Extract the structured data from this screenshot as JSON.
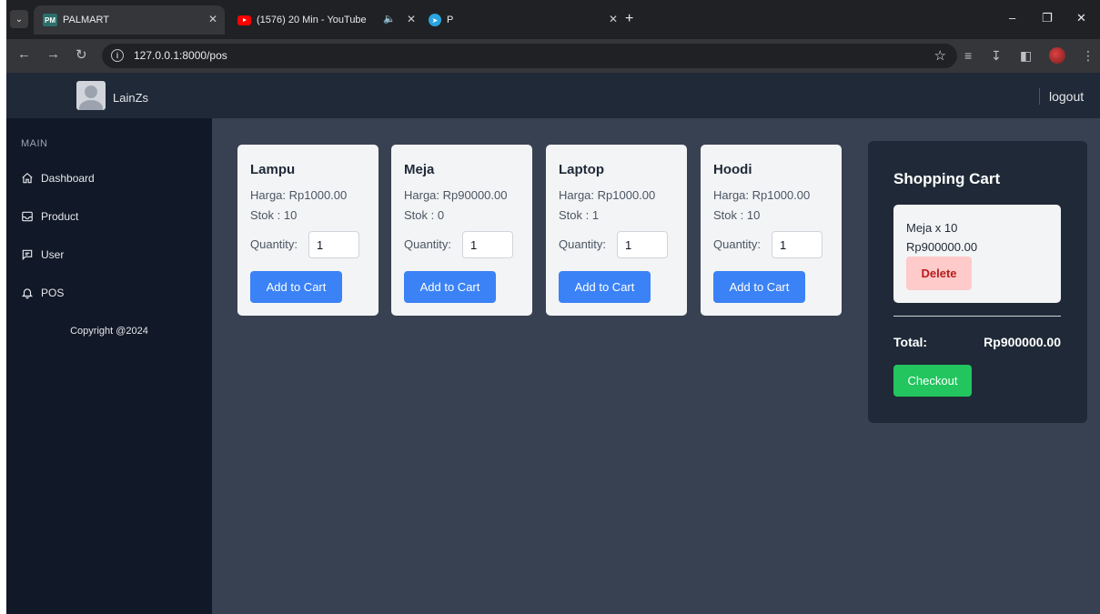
{
  "browser": {
    "tabs": [
      {
        "title": "PALMART",
        "favicon": "PM"
      },
      {
        "title": "(1576) 20 Min - YouTube"
      },
      {
        "title": "P"
      }
    ],
    "url": "127.0.0.1:8000/pos"
  },
  "header": {
    "username": "LainZs",
    "logout_label": "logout"
  },
  "sidebar": {
    "section": "MAIN",
    "items": [
      {
        "label": "Dashboard",
        "icon": "home-icon"
      },
      {
        "label": "Product",
        "icon": "inbox-icon"
      },
      {
        "label": "User",
        "icon": "chat-icon"
      },
      {
        "label": "POS",
        "icon": "bell-icon"
      }
    ],
    "copyright": "Copyright @2024"
  },
  "products": [
    {
      "name": "Lampu",
      "price": "Harga: Rp1000.00",
      "stock": "Stok : 10",
      "quantity_label": "Quantity:",
      "quantity": "1",
      "button": "Add to Cart"
    },
    {
      "name": "Meja",
      "price": "Harga: Rp90000.00",
      "stock": "Stok : 0",
      "quantity_label": "Quantity:",
      "quantity": "1",
      "button": "Add to Cart"
    },
    {
      "name": "Laptop",
      "price": "Harga: Rp1000.00",
      "stock": "Stok : 1",
      "quantity_label": "Quantity:",
      "quantity": "1",
      "button": "Add to Cart"
    },
    {
      "name": "Hoodi",
      "price": "Harga: Rp1000.00",
      "stock": "Stok : 10",
      "quantity_label": "Quantity:",
      "quantity": "1",
      "button": "Add to Cart"
    }
  ],
  "cart": {
    "title": "Shopping Cart",
    "items": [
      {
        "name": "Meja x 10",
        "price": "Rp900000.00",
        "delete_label": "Delete"
      }
    ],
    "total_label": "Total:",
    "total_value": "Rp900000.00",
    "checkout_label": "Checkout"
  },
  "colors": {
    "primary_button": "#3b82f6",
    "checkout_button": "#22c55e",
    "delete_button_bg": "#fecaca",
    "sidebar_bg": "#111827",
    "main_bg": "#374151"
  }
}
